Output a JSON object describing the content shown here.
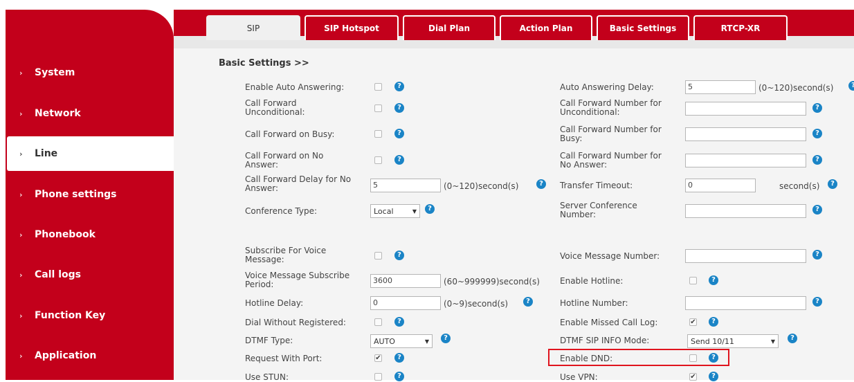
{
  "tabs": [
    "SIP",
    "SIP Hotspot",
    "Dial Plan",
    "Action Plan",
    "Basic Settings",
    "RTCP-XR"
  ],
  "sidebar": {
    "items": [
      "System",
      "Network",
      "Line",
      "Phone settings",
      "Phonebook",
      "Call logs",
      "Function Key",
      "Application"
    ],
    "active": "Line"
  },
  "section_title": "Basic Settings >>",
  "left": {
    "auto_answer": "Enable Auto Answering:",
    "cf_uncond": [
      "Call Forward",
      "Unconditional:"
    ],
    "cf_busy": "Call Forward on Busy:",
    "cf_noanswer": [
      "Call Forward on No",
      "Answer:"
    ],
    "cf_delay": [
      "Call Forward Delay for No",
      "Answer:"
    ],
    "cf_delay_value": "5",
    "cf_delay_unit": "(0~120)second(s)",
    "conf_type": "Conference Type:",
    "conf_type_value": "Local",
    "sub_voice": [
      "Subscribe For Voice",
      "Message:"
    ],
    "vm_period": [
      "Voice Message Subscribe",
      "Period:"
    ],
    "vm_period_value": "3600",
    "vm_period_unit": "(60~999999)second(s)",
    "hotline_delay": "Hotline Delay:",
    "hotline_delay_value": "0",
    "hotline_delay_unit": "(0~9)second(s)",
    "dial_wo_reg": "Dial Without Registered:",
    "dtmf_type": "DTMF Type:",
    "dtmf_type_value": "AUTO",
    "req_port": "Request With Port:",
    "use_stun": "Use STUN:"
  },
  "right": {
    "aa_delay": "Auto Answering Delay:",
    "aa_delay_value": "5",
    "aa_delay_unit": "(0~120)second(s)",
    "cfn_uncond": [
      "Call Forward Number for",
      "Unconditional:"
    ],
    "cfn_busy": [
      "Call Forward Number for",
      "Busy:"
    ],
    "cfn_noanswer": [
      "Call Forward Number for",
      "No Answer:"
    ],
    "transfer_timeout": "Transfer Timeout:",
    "transfer_timeout_value": "0",
    "transfer_timeout_unit": "second(s)",
    "server_conf": [
      "Server Conference",
      "Number:"
    ],
    "vm_number": "Voice Message Number:",
    "enable_hotline": "Enable Hotline:",
    "hotline_number": "Hotline Number:",
    "missed_log": "Enable Missed Call Log:",
    "dtmf_sip_info": "DTMF SIP INFO Mode:",
    "dtmf_sip_info_value": "Send 10/11",
    "enable_dnd": "Enable DND:",
    "use_vpn": "Use VPN:"
  },
  "help_glyph": "?",
  "check_glyph": "✔",
  "dropdown_glyph": "▼",
  "chevron_glyph": "›",
  "colors": {
    "brand_red": "#c3001b",
    "help_blue": "#1a84c6",
    "highlight": "#e0141e"
  }
}
